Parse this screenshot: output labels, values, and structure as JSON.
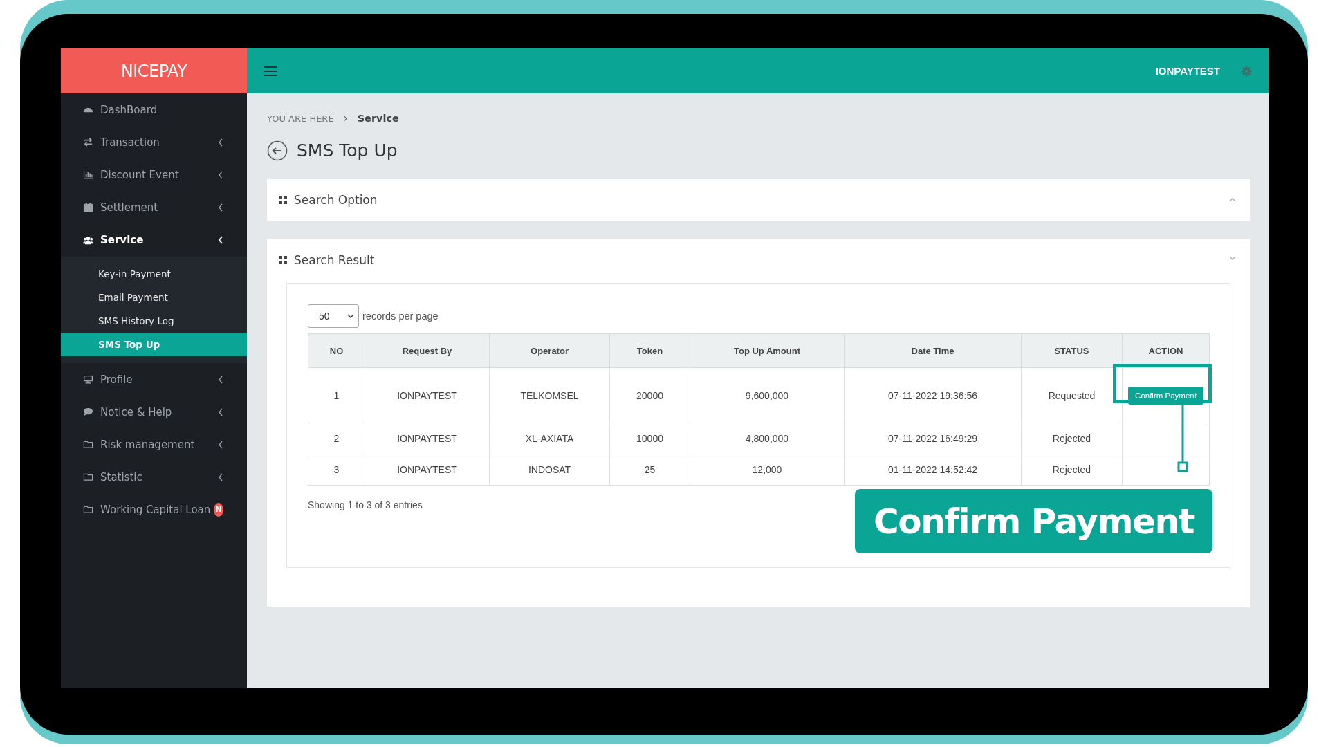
{
  "brand": "NICEPAY",
  "sidebar": {
    "items": [
      {
        "label": "DashBoard",
        "kind": "link",
        "selected": false
      },
      {
        "label": "Transaction",
        "kind": "menu",
        "selected": false
      },
      {
        "label": "Discount Event",
        "kind": "menu",
        "selected": false
      },
      {
        "label": "Settlement",
        "kind": "menu",
        "selected": false
      },
      {
        "label": "Service",
        "kind": "menu",
        "selected": true,
        "children": [
          {
            "label": "Key-in Payment",
            "selected": false
          },
          {
            "label": "Email Payment",
            "selected": false
          },
          {
            "label": "SMS History Log",
            "selected": false
          },
          {
            "label": "SMS Top Up",
            "selected": true
          }
        ]
      },
      {
        "label": "Profile",
        "kind": "menu",
        "selected": false
      },
      {
        "label": "Notice & Help",
        "kind": "menu",
        "selected": false
      },
      {
        "label": "Risk management",
        "kind": "menu",
        "selected": false
      },
      {
        "label": "Statistic",
        "kind": "menu",
        "selected": false
      },
      {
        "label": "Working Capital Loan",
        "kind": "link",
        "selected": false,
        "badge": "N"
      }
    ]
  },
  "header": {
    "user": "IONPAYTEST"
  },
  "breadcrumb": {
    "prefix": "YOU ARE HERE",
    "separator": "›",
    "current": "Service"
  },
  "page_title": "SMS Top Up",
  "panels": [
    {
      "title": "Search Option",
      "expanded": false
    },
    {
      "title": "Search Result",
      "expanded": true
    }
  ],
  "table": {
    "page_size": "50",
    "page_size_label": "records per page",
    "columns": [
      "NO",
      "Request By",
      "Operator",
      "Token",
      "Top Up Amount",
      "Date Time",
      "STATUS",
      "ACTION"
    ],
    "rows": [
      {
        "no": "1",
        "request_by": "IONPAYTEST",
        "operator": "TELKOMSEL",
        "token": "20000",
        "amount": "9,600,000",
        "date_time": "07-11-2022 19:36:56",
        "status": "Requested",
        "action": "Confirm Payment"
      },
      {
        "no": "2",
        "request_by": "IONPAYTEST",
        "operator": "XL-AXIATA",
        "token": "10000",
        "amount": "4,800,000",
        "date_time": "07-11-2022 16:49:29",
        "status": "Rejected"
      },
      {
        "no": "3",
        "request_by": "IONPAYTEST",
        "operator": "INDOSAT",
        "token": "25",
        "amount": "12,000",
        "date_time": "01-11-2022 14:52:42",
        "status": "Rejected"
      }
    ],
    "footer": "Showing 1 to 3 of 3 entries"
  },
  "callout": {
    "label": "Confirm Payment"
  }
}
